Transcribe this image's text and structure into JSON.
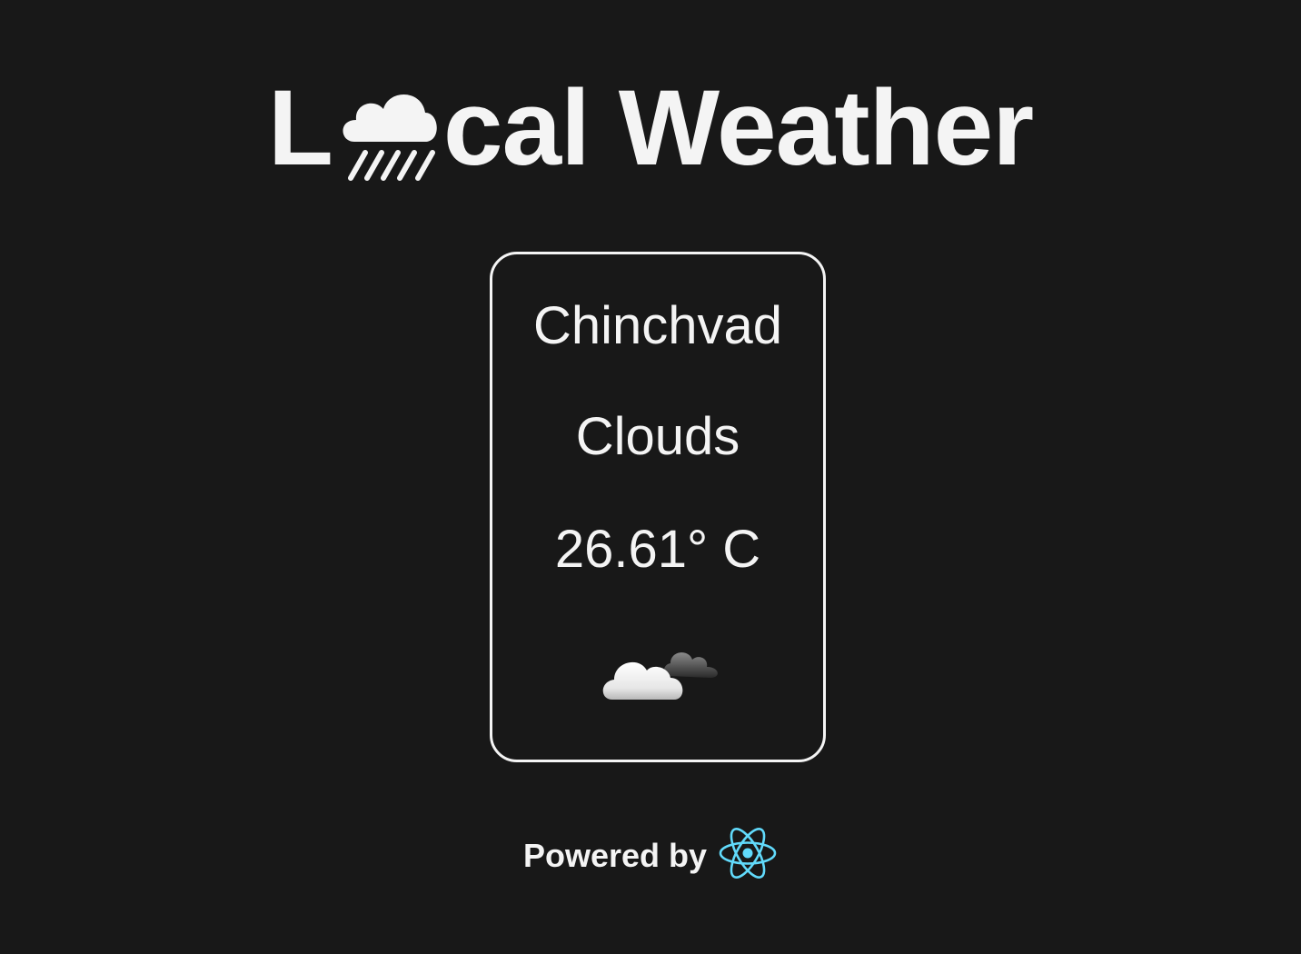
{
  "header": {
    "title_prefix": "L",
    "title_suffix": "cal Weather",
    "logo_icon": "cloud-rain-icon"
  },
  "weather": {
    "city": "Chinchvad",
    "condition": "Clouds",
    "temperature": "26.61° C",
    "condition_icon": "clouds-icon"
  },
  "footer": {
    "powered_label": "Powered by",
    "powered_icon": "react-logo-icon"
  },
  "colors": {
    "background": "#181818",
    "foreground": "#f4f4f4",
    "react_blue": "#61dafb"
  }
}
